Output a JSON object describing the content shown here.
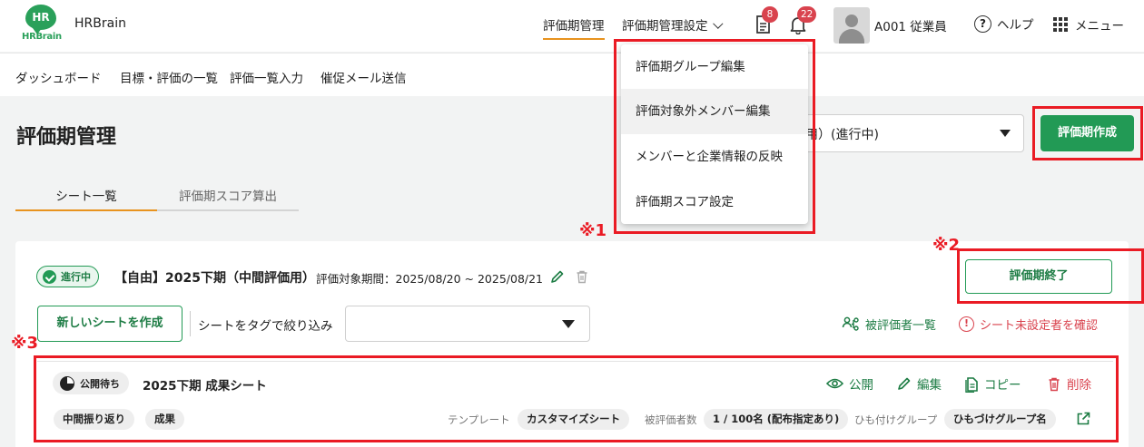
{
  "header": {
    "logo_mark": "HR",
    "logo_word": "HRBrain",
    "brand": "HRBrain",
    "nav_active": "評価期管理",
    "nav_settings": "評価期管理設定",
    "task_badge": "8",
    "notification_badge": "22",
    "user_name": "A001 従業員",
    "help_label": "ヘルプ",
    "menu_label": "メニュー"
  },
  "subnav": {
    "items": [
      "ダッシュボード",
      "目標・評価の一覧",
      "評価一覧入力",
      "催促メール送信"
    ]
  },
  "dropdown": {
    "items": [
      "評価期グループ編集",
      "評価対象外メンバー編集",
      "メンバーと企業情報の反映",
      "評価期スコア設定"
    ]
  },
  "page": {
    "title": "評価期管理",
    "period_select_value": "用）(進行中)",
    "create_period_button": "評価期作成",
    "tabs": [
      "シート一覧",
      "評価期スコア算出"
    ]
  },
  "period": {
    "status": "進行中",
    "name": "【自由】2025下期（中間評価用）",
    "range": "評価対象期間：2025/08/20 ~ 2025/08/21",
    "end_button": "評価期終了",
    "new_sheet_button": "新しいシートを作成",
    "tag_filter_label": "シートをタグで絞り込み",
    "tag_filter_value": "",
    "evaluatee_list_link": "被評価者一覧",
    "unset_check_link": "シート未設定者を確認"
  },
  "sheet": {
    "status": "公開待ち",
    "name": "2025下期 成果シート",
    "actions": {
      "publish": "公開",
      "edit": "編集",
      "copy": "コピー",
      "delete": "削除"
    },
    "tags": [
      "中間振り返り",
      "成果"
    ],
    "template_label": "テンプレート",
    "template_value": "カスタマイズシート",
    "evaluatee_count_label": "被評価者数",
    "evaluatee_count_value": "1 / 100名 (配布指定あり)",
    "group_label": "ひも付けグループ",
    "group_value": "ひもづけグループ名"
  },
  "annotations": {
    "note1": "※1",
    "note2": "※2",
    "note3": "※3"
  },
  "colors": {
    "accent_green": "#229a55",
    "warning_red": "#d9434e",
    "annotation_red": "#ea1b24",
    "active_underline": "#e8931e"
  }
}
